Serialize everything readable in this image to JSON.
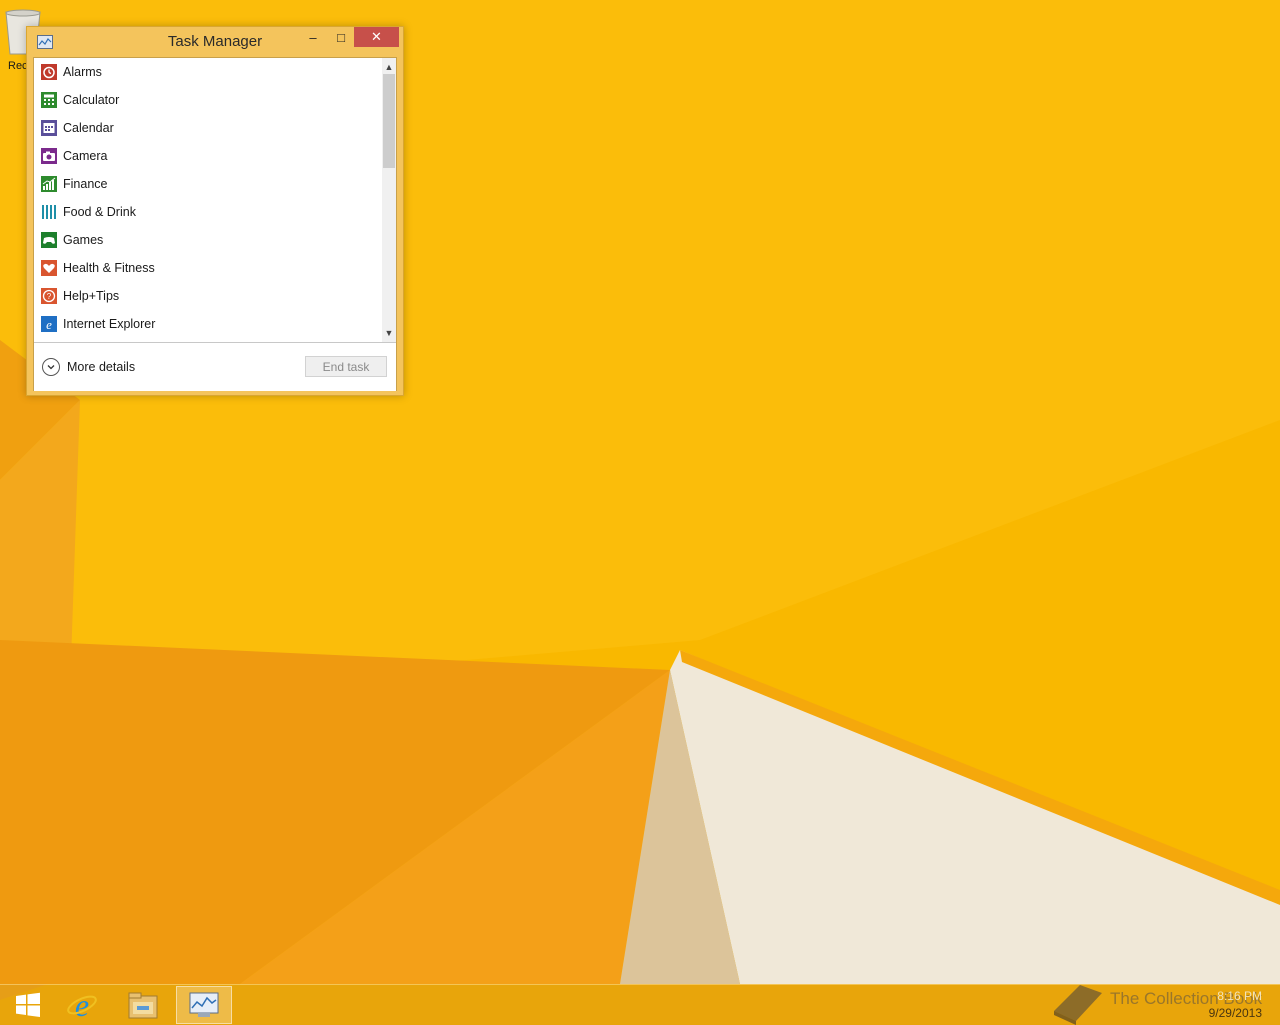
{
  "desktop": {
    "recycle_bin_label": "Rec"
  },
  "window": {
    "title": "Task Manager",
    "minimize_glyph": "–",
    "maximize_glyph": "□",
    "close_glyph": "✕",
    "apps": [
      {
        "label": "Alarms",
        "icon": "alarm-icon",
        "color": "#c0392b"
      },
      {
        "label": "Calculator",
        "icon": "calculator-icon",
        "color": "#2e8b2e"
      },
      {
        "label": "Calendar",
        "icon": "calendar-icon",
        "color": "#5a4f9a"
      },
      {
        "label": "Camera",
        "icon": "camera-icon",
        "color": "#7b2a8c"
      },
      {
        "label": "Finance",
        "icon": "finance-icon",
        "color": "#2e8b2e"
      },
      {
        "label": "Food & Drink",
        "icon": "food-drink-icon",
        "color": "#1f8fa8"
      },
      {
        "label": "Games",
        "icon": "games-icon",
        "color": "#1d7f2c"
      },
      {
        "label": "Health & Fitness",
        "icon": "health-fitness-icon",
        "color": "#d9552f"
      },
      {
        "label": "Help+Tips",
        "icon": "help-tips-icon",
        "color": "#d9552f"
      },
      {
        "label": "Internet Explorer",
        "icon": "internet-explorer-icon",
        "color": "#1f6fc4"
      }
    ],
    "scroll_up_glyph": "▲",
    "scroll_down_glyph": "▼",
    "more_details_label": "More details",
    "more_details_glyph": "⌄",
    "end_task_label": "End task"
  },
  "taskbar": {
    "items": [
      {
        "name": "start-button",
        "icon": "windows-logo-icon"
      },
      {
        "name": "taskbar-internet-explorer",
        "icon": "internet-explorer-icon"
      },
      {
        "name": "taskbar-file-explorer",
        "icon": "file-explorer-icon"
      },
      {
        "name": "taskbar-task-manager",
        "icon": "task-manager-icon",
        "active": true
      }
    ],
    "clock_time": "8:16 PM",
    "clock_date": "9/29/2013",
    "watermark": "The Collection Book"
  },
  "colors": {
    "wallpaper": "#f7b500",
    "window_frame": "#f4c45c",
    "close_button": "#c7504a"
  }
}
